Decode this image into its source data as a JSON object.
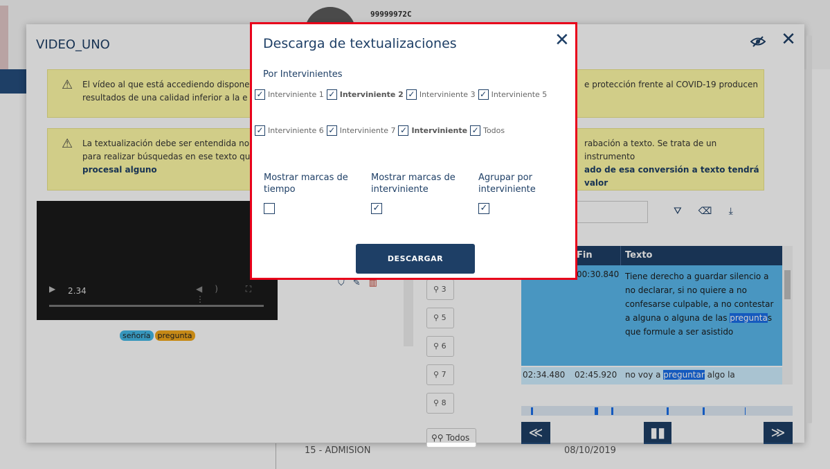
{
  "background": {
    "code": "99999972C",
    "footer_left": "15 - ADMISION",
    "footer_right": "08/10/2019"
  },
  "modal": {
    "title": "VIDEO_UNO",
    "close_label": "✕",
    "warning1_left": "El vídeo al que está accediendo dispone resultados de una calidad inferior a la e",
    "warning1_right": "e protección frente al COVID-19 producen",
    "warning2_left": "La textualización debe ser entendida no para realizar búsquedas en ese texto qu",
    "warning2_bold": "procesal alguno",
    "warning2_right": "rabación a texto. Se trata de un instrumento",
    "warning2_right_bold": "ado de esa conversión a texto tendrá valor"
  },
  "video": {
    "time": "2.34",
    "tags": [
      "señoría",
      "pregunta"
    ]
  },
  "speakers": [
    "3",
    "5",
    "6",
    "7",
    "8"
  ],
  "speakers_all": "Todos",
  "table": {
    "col_fin": "Fin",
    "col_text": "Texto",
    "row1_time": "00:30.840",
    "row1_text_before": "Tiene derecho a guardar silencio a no declarar, si no quiere a no confesarse culpable, a no contestar a alguna o alguna de las ",
    "row1_highlight": "pregunta",
    "row1_text_after": "s que formule a ser asistido",
    "row2_start": "02:34.480",
    "row2_end": "02:45.920",
    "row2_text_before": "no voy a ",
    "row2_highlight": "preguntar",
    "row2_text_after": " algo la"
  },
  "nav": {
    "prev": "≪",
    "pause": "▮▮",
    "next": "≫"
  },
  "dialog": {
    "title": "Descarga de textualizaciones",
    "close_label": "✕",
    "subtitle": "Por Intervinientes",
    "row1": [
      {
        "label": "Interviniente 1",
        "bold": false
      },
      {
        "label": "Interviniente 2",
        "bold": true
      },
      {
        "label": "Interviniente 3",
        "bold": false
      },
      {
        "label": "Interviniente 5",
        "bold": false
      }
    ],
    "row2": [
      {
        "label": "Interviniente 6",
        "bold": false
      },
      {
        "label": "Interviniente 7",
        "bold": false
      },
      {
        "label": "Interviniente",
        "bold": true
      },
      {
        "label": "Todos",
        "bold": false
      }
    ],
    "opt_time": "Mostrar marcas de tiempo",
    "opt_speaker": "Mostrar marcas de interviniente",
    "opt_group": "Agrupar por interviniente",
    "opt_time_checked": false,
    "opt_speaker_checked": true,
    "opt_group_checked": true,
    "download_label": "DESCARGAR"
  },
  "colors": {
    "primary": "#1e3f66",
    "highlight": "#e8001a",
    "accent": "#1a6ee8"
  }
}
